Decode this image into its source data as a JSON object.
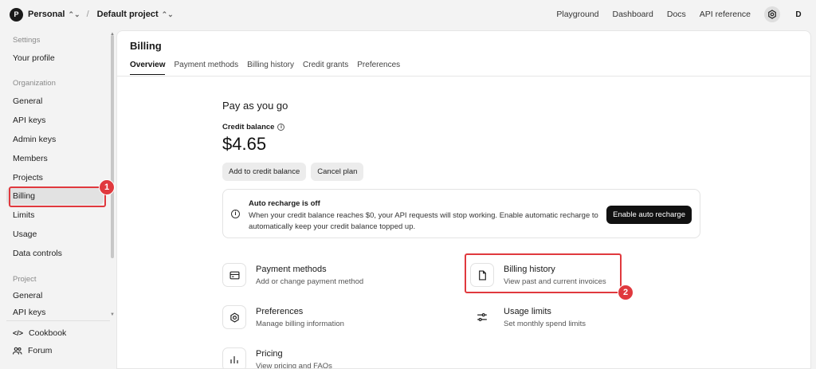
{
  "topbar": {
    "org_initial": "P",
    "org_name": "Personal",
    "project_name": "Default project",
    "nav": [
      "Playground",
      "Dashboard",
      "Docs",
      "API reference"
    ],
    "settings_icon": "gear-icon",
    "user_initial": "D"
  },
  "sidebar": {
    "settings_label": "Settings",
    "your_profile": "Your profile",
    "organization_label": "Organization",
    "org_items": [
      "General",
      "API keys",
      "Admin keys",
      "Members",
      "Projects",
      "Billing",
      "Limits",
      "Usage",
      "Data controls"
    ],
    "project_label": "Project",
    "project_items": [
      "General",
      "API keys"
    ],
    "footer": [
      {
        "label": "Cookbook",
        "icon": "code-icon"
      },
      {
        "label": "Forum",
        "icon": "people-icon"
      }
    ]
  },
  "main": {
    "title": "Billing",
    "tabs": [
      "Overview",
      "Payment methods",
      "Billing history",
      "Credit grants",
      "Preferences"
    ],
    "active_tab": "Overview",
    "plan_title": "Pay as you go",
    "credit_label": "Credit balance",
    "balance": "$4.65",
    "add_credit": "Add to credit balance",
    "cancel_plan": "Cancel plan",
    "notice_title": "Auto recharge is off",
    "notice_desc": "When your credit balance reaches $0, your API requests will stop working. Enable automatic recharge to automatically keep your credit balance topped up.",
    "enable_recharge": "Enable auto recharge",
    "cards": [
      {
        "title": "Payment methods",
        "desc": "Add or change payment method",
        "icon": "credit-card-icon"
      },
      {
        "title": "Billing history",
        "desc": "View past and current invoices",
        "icon": "document-icon"
      },
      {
        "title": "Preferences",
        "desc": "Manage billing information",
        "icon": "gear-icon"
      },
      {
        "title": "Usage limits",
        "desc": "Set monthly spend limits",
        "icon": "sliders-icon"
      },
      {
        "title": "Pricing",
        "desc": "View pricing and FAQs",
        "icon": "bar-chart-icon"
      }
    ]
  },
  "annotations": {
    "badge_1": "1",
    "badge_2": "2",
    "color": "#e0393e"
  }
}
